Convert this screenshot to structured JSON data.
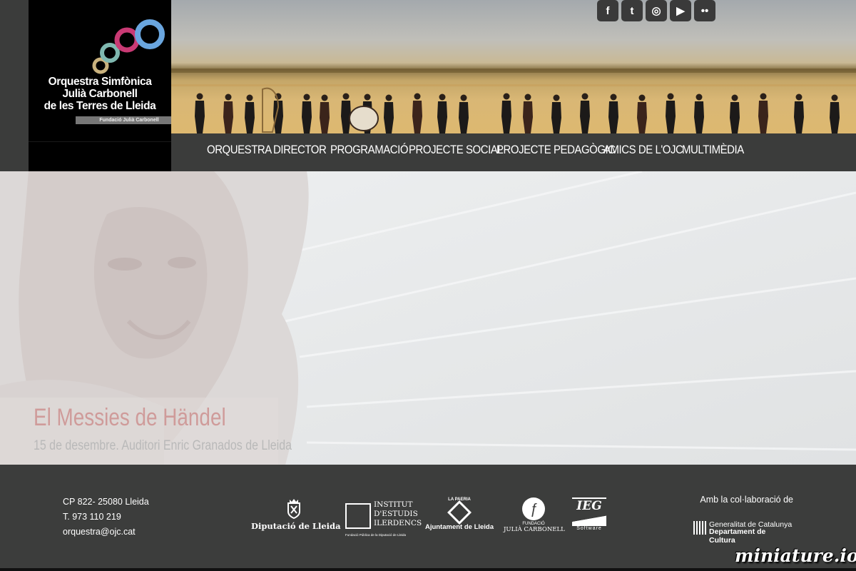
{
  "logo": {
    "name_lines": [
      "Orquestra Simfònica",
      "Julià Carbonell",
      "de les Terres de Lleida"
    ],
    "foundation": "Fundació Julià Carbonell",
    "ring_colors": [
      "#c9b27e",
      "#7fb8b0",
      "#c93a74",
      "#6aa6df"
    ]
  },
  "social": [
    {
      "icon": "facebook-icon",
      "glyph": "f"
    },
    {
      "icon": "twitter-icon",
      "glyph": "t"
    },
    {
      "icon": "instagram-icon",
      "glyph": "◎"
    },
    {
      "icon": "youtube-icon",
      "glyph": "▶"
    },
    {
      "icon": "flickr-icon",
      "glyph": "••"
    }
  ],
  "nav": {
    "items": [
      "ORQUESTRA",
      "DIRECTOR",
      "PROGRAMACIÓ",
      "PROJECTE SOCIAL",
      "PROJECTE PEDAGÒGIC",
      "AMICS DE L'OJC",
      "MULTIMÈDIA"
    ]
  },
  "hero": {
    "title": "El Messies de Händel",
    "subtitle": "15 de desembre. Auditori Enric Granados de Lleida"
  },
  "footer": {
    "contact": [
      "CP 822- 25080 Lleida",
      "T. 973 110 219",
      "orquestra@ojc.cat"
    ],
    "partners": {
      "diputacio": "Diputació de Lleida",
      "iei_lines": [
        "INSTITUT",
        "D'ESTUDIS",
        "ILERDENCS"
      ],
      "iei_sub": "Fundació Pública de la Diputació de Lleida",
      "paeria_top": "LA PAERIA",
      "paeria": "Ajuntament de Lleida",
      "fundacio_small": "FUNDACIÓ",
      "fundacio": "JULIÀ CARBONELL",
      "ieg": "IEG",
      "ieg_sub": "Software"
    },
    "collab_label": "Amb la col·laboració de",
    "gencat_line1": "Generalitat de Catalunya",
    "gencat_line2": "Departament de Cultura"
  },
  "watermark": "miniature.io"
}
